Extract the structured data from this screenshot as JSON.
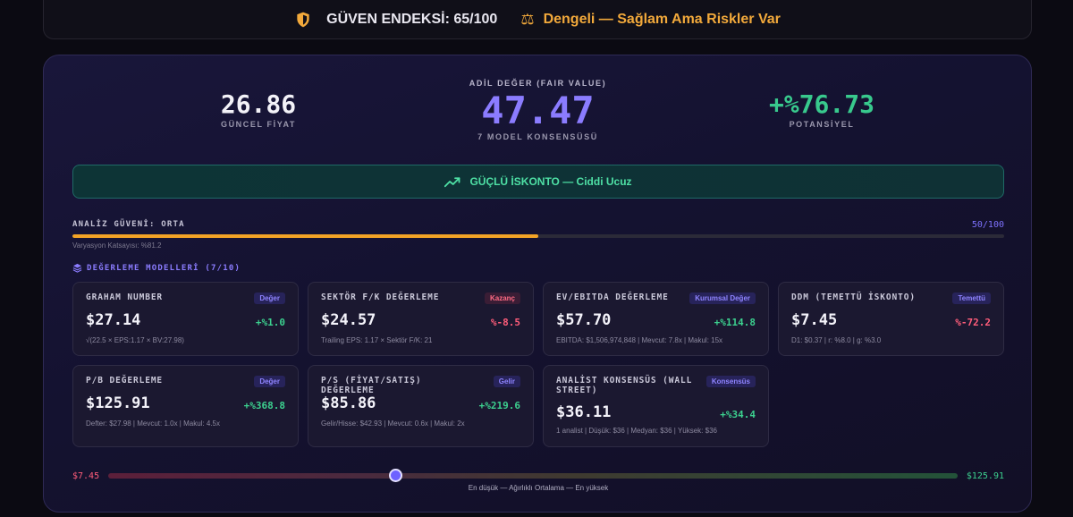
{
  "trust": {
    "label": "GÜVEN ENDEKSİ: 65/100",
    "verdict": "Dengeli — Sağlam Ama Riskler Var",
    "color": "#f2a93b"
  },
  "hero": {
    "current_price": "26.86",
    "current_label": "GÜNCEL FİYAT",
    "fair_caption": "ADİL DEĞER (FAIR VALUE)",
    "fair_value": "47.47",
    "fair_sub": "7 MODEL KONSENSÜSÜ",
    "potential": "+%76.73",
    "potential_label": "POTANSİYEL"
  },
  "verdict": {
    "text": "GÜÇLÜ İSKONTO — Ciddi Ucuz",
    "color": "#4ee0a5"
  },
  "confidence": {
    "label": "ANALİZ GÜVENİ: ORTA",
    "value": "50/100",
    "fill_fraction": 0.5,
    "variance": "Varyasyon Katsayısı: %81.2"
  },
  "models": {
    "header": "DEĞERLEME MODELLERİ (7/10)",
    "items": [
      {
        "title": "GRAHAM NUMBER",
        "badge": "Değer",
        "badge_tone": "blue",
        "value": "$27.14",
        "delta": "+%1.0",
        "delta_tone": "pos",
        "sub": "√(22.5 × EPS:1.17 × BV:27.98)"
      },
      {
        "title": "SEKTÖR F/K DEĞERLEME",
        "badge": "Kazanç",
        "badge_tone": "red",
        "value": "$24.57",
        "delta": "%-8.5",
        "delta_tone": "neg",
        "sub": "Trailing EPS: 1.17 × Sektör F/K: 21"
      },
      {
        "title": "EV/EBITDA DEĞERLEME",
        "badge": "Kurumsal Değer",
        "badge_tone": "blue",
        "value": "$57.70",
        "delta": "+%114.8",
        "delta_tone": "pos",
        "sub": "EBITDA: $1,506,974,848 | Mevcut: 7.8x | Makul: 15x"
      },
      {
        "title": "DDM (TEMETTÜ İSKONTO)",
        "badge": "Temettü",
        "badge_tone": "blue",
        "value": "$7.45",
        "delta": "%-72.2",
        "delta_tone": "neg",
        "sub": "D1: $0.37 | r: %8.0 | g: %3.0"
      },
      {
        "title": "P/B DEĞERLEME",
        "badge": "Değer",
        "badge_tone": "blue",
        "value": "$125.91",
        "delta": "+%368.8",
        "delta_tone": "pos",
        "sub": "Defter: $27.98 | Mevcut: 1.0x | Makul: 4.5x"
      },
      {
        "title": "P/S (FİYAT/SATIŞ) DEĞERLEME",
        "badge": "Gelir",
        "badge_tone": "blue",
        "value": "$85.86",
        "delta": "+%219.6",
        "delta_tone": "pos",
        "sub": "Gelir/Hisse: $42.93 | Mevcut: 0.6x | Makul: 2x"
      },
      {
        "title": "ANALİST KONSENSÜS (WALL STREET)",
        "badge": "Konsensüs",
        "badge_tone": "blue",
        "value": "$36.11",
        "delta": "+%34.4",
        "delta_tone": "pos",
        "sub": "1 analist | Düşük: $36 | Medyan: $36 | Yüksek: $36"
      }
    ]
  },
  "range": {
    "low": "$7.45",
    "high": "$125.91",
    "marker_fraction": 0.338,
    "caption": "En düşük — Ağırlıklı Ortalama — En yüksek"
  }
}
